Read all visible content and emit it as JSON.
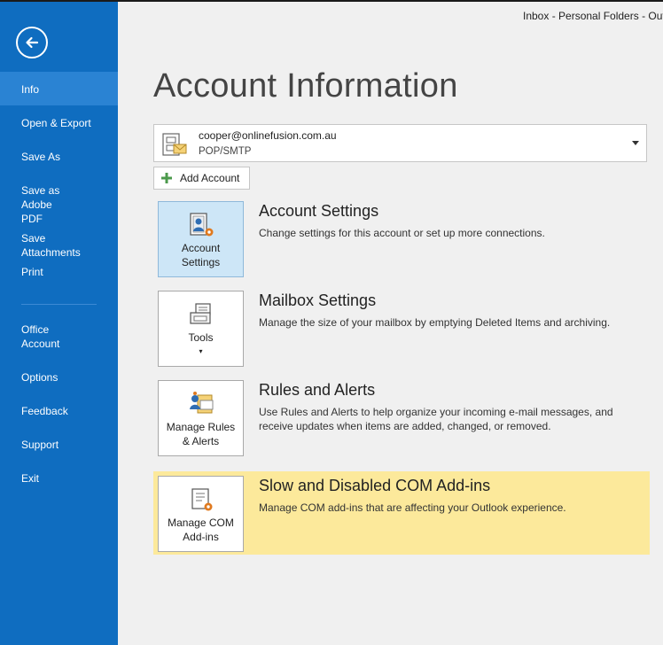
{
  "window": {
    "title": "Inbox - Personal Folders - Out"
  },
  "sidebar": {
    "items": [
      {
        "label": "Info",
        "active": true
      },
      {
        "label": "Open & Export"
      },
      {
        "label": "Save As"
      },
      {
        "label": "Save as Adobe PDF"
      },
      {
        "label": "Save Attachments"
      },
      {
        "label": "Print"
      },
      {
        "label": "Office Account"
      },
      {
        "label": "Options"
      },
      {
        "label": "Feedback"
      },
      {
        "label": "Support"
      },
      {
        "label": "Exit"
      }
    ]
  },
  "main": {
    "title": "Account Information",
    "account": {
      "email": "cooper@onlinefusion.com.au",
      "type": "POP/SMTP"
    },
    "add_account_label": "Add Account",
    "sections": [
      {
        "tile_label": "Account Settings",
        "title": "Account Settings",
        "description": "Change settings for this account or set up more connections."
      },
      {
        "tile_label": "Tools",
        "title": "Mailbox Settings",
        "description": "Manage the size of your mailbox by emptying Deleted Items and archiving."
      },
      {
        "tile_label": "Manage Rules & Alerts",
        "title": "Rules and Alerts",
        "description": "Use Rules and Alerts to help organize your incoming e-mail messages, and receive updates when items are added, changed, or removed."
      },
      {
        "tile_label": "Manage COM Add-ins",
        "title": "Slow and Disabled COM Add-ins",
        "description": "Manage COM add-ins that are affecting your Outlook experience."
      }
    ]
  },
  "colors": {
    "sidebar": "#0f6dc0",
    "sidebar_active": "#2a83d3",
    "highlight": "#fce99b",
    "tile_selected": "#cde6f7"
  }
}
